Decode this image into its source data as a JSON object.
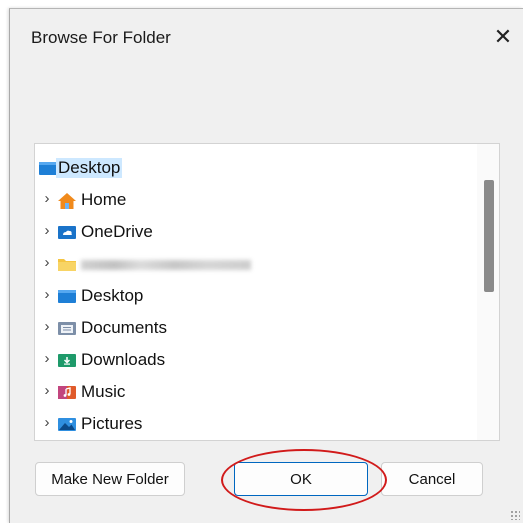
{
  "dialog": {
    "title": "Browse For Folder",
    "close_glyph": "✕"
  },
  "tree": {
    "root": {
      "label": "Desktop",
      "icon": "desktop-folder-icon",
      "selected": true
    },
    "items": [
      {
        "label": "Home",
        "icon": "home-icon"
      },
      {
        "label": "OneDrive",
        "icon": "onedrive-folder-icon"
      },
      {
        "label": "",
        "icon": "user-folder-icon",
        "blurred": true
      },
      {
        "label": "Desktop",
        "icon": "desktop-folder-icon"
      },
      {
        "label": "Documents",
        "icon": "documents-folder-icon"
      },
      {
        "label": "Downloads",
        "icon": "downloads-folder-icon"
      },
      {
        "label": "Music",
        "icon": "music-folder-icon"
      },
      {
        "label": "Pictures",
        "icon": "pictures-folder-icon"
      }
    ],
    "expand_glyph": "›"
  },
  "buttons": {
    "make_new_folder": "Make New Folder",
    "ok": "OK",
    "cancel": "Cancel"
  },
  "colors": {
    "selection": "#cde8ff",
    "annotation_oval": "#d11a1a",
    "default_button_border": "#0067c0"
  }
}
